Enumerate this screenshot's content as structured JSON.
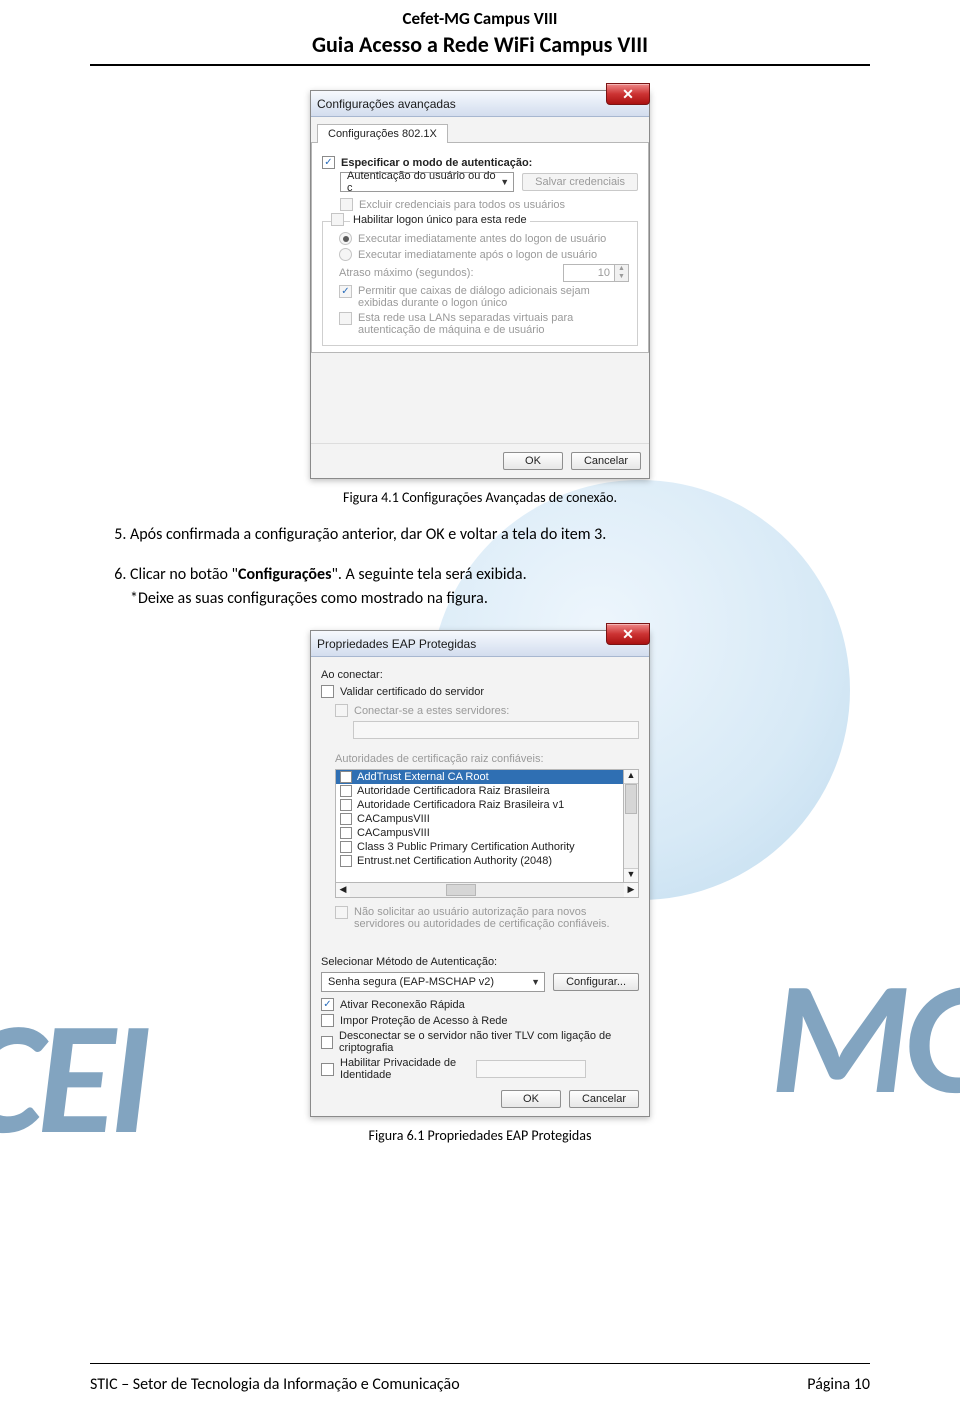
{
  "doc": {
    "header_line1": "Cefet-MG Campus VIII",
    "header_line2": "Guia Acesso a Rede WiFi Campus VIII",
    "caption1": "Figura 4.1 Configurações Avançadas de conexão.",
    "step5": "Após confirmada a configuração anterior, dar OK e voltar a tela do item 3.",
    "step6_pre": "Clicar no botão \"",
    "step6_bold": "Configurações",
    "step6_post": "\". A seguinte tela será exibida.",
    "step6_note": "*Deixe as suas configurações como mostrado na figura.",
    "caption2": "Figura 6.1 Propriedades EAP Protegidas",
    "footer_left": "STIC – Setor de Tecnologia da Informação e Comunicação",
    "footer_right": "Página 10"
  },
  "dlg1": {
    "title": "Configurações avançadas",
    "tab": "Configurações 802.1X",
    "chk_specify": "Especificar o modo de autenticação:",
    "combo_auth": "Autenticação do usuário ou do c",
    "btn_save_cred": "Salvar credenciais",
    "chk_exclude": "Excluir credenciais para todos os usuários",
    "chk_sso": "Habilitar logon único para esta rede",
    "rdo_before": "Executar imediatamente antes do logon de usuário",
    "rdo_after": "Executar imediatamente após o logon de usuário",
    "lbl_delay": "Atraso máximo (segundos):",
    "delay_value": "10",
    "chk_dialogs": "Permitir que caixas de diálogo adicionais sejam exibidas durante o logon único",
    "chk_vlan": "Esta rede usa LANs separadas virtuais para autenticação de máquina e de usuário",
    "btn_ok": "OK",
    "btn_cancel": "Cancelar"
  },
  "dlg2": {
    "title": "Propriedades EAP Protegidas",
    "lbl_connect": "Ao conectar:",
    "chk_validate": "Validar certificado do servidor",
    "chk_connect_servers": "Conectar-se a estes servidores:",
    "lbl_ca": "Autoridades de certificação raiz confiáveis:",
    "ca_list": [
      "AddTrust External CA Root",
      "Autoridade Certificadora Raiz Brasileira",
      "Autoridade Certificadora Raiz Brasileira v1",
      "CACampusVIII",
      "CACampusVIII",
      "Class 3 Public Primary Certification Authority",
      "Entrust.net Certification Authority (2048)"
    ],
    "chk_noprompt": "Não solicitar ao usuário autorização para novos servidores ou autoridades de certificação confiáveis.",
    "lbl_method": "Selecionar Método de Autenticação:",
    "combo_method": "Senha segura (EAP-MSCHAP v2)",
    "btn_configure": "Configurar...",
    "chk_fast": "Ativar Reconexão Rápida",
    "chk_nap": "Impor Proteção de Acesso à Rede",
    "chk_tlv": "Desconectar se o servidor não tiver TLV com ligação de criptografia",
    "chk_priv": "Habilitar Privacidade de Identidade",
    "btn_ok": "OK",
    "btn_cancel": "Cancelar"
  }
}
